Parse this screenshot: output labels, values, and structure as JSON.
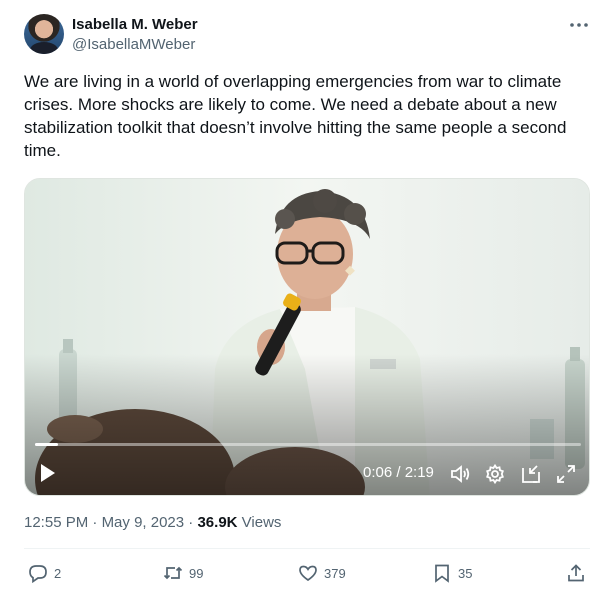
{
  "author": {
    "name": "Isabella M. Weber",
    "handle": "@IsabellaMWeber",
    "more_icon": "ellipsis-icon"
  },
  "tweet": {
    "text": "We are living in a world of overlapping emergencies from war to climate crises. More shocks are likely to come. We need a debate about a new stabilization toolkit that doesn’t involve hitting the same people a second time."
  },
  "video": {
    "time_display": "0:06 / 2:19",
    "progress_fraction": 0.043,
    "controls": [
      "play-icon",
      "volume-icon",
      "settings-gear-icon",
      "picture-in-picture-icon",
      "fullscreen-icon"
    ]
  },
  "meta": {
    "time": "12:55 PM",
    "separator": " · ",
    "date": "May 9, 2023",
    "views_count": "36.9K",
    "views_label": "Views"
  },
  "actions": {
    "replies": "2",
    "reposts": "99",
    "likes": "379",
    "bookmarks": "35"
  },
  "colors": {
    "text_primary": "#0f1419",
    "text_secondary": "#536471",
    "divider": "#eff3f4"
  }
}
